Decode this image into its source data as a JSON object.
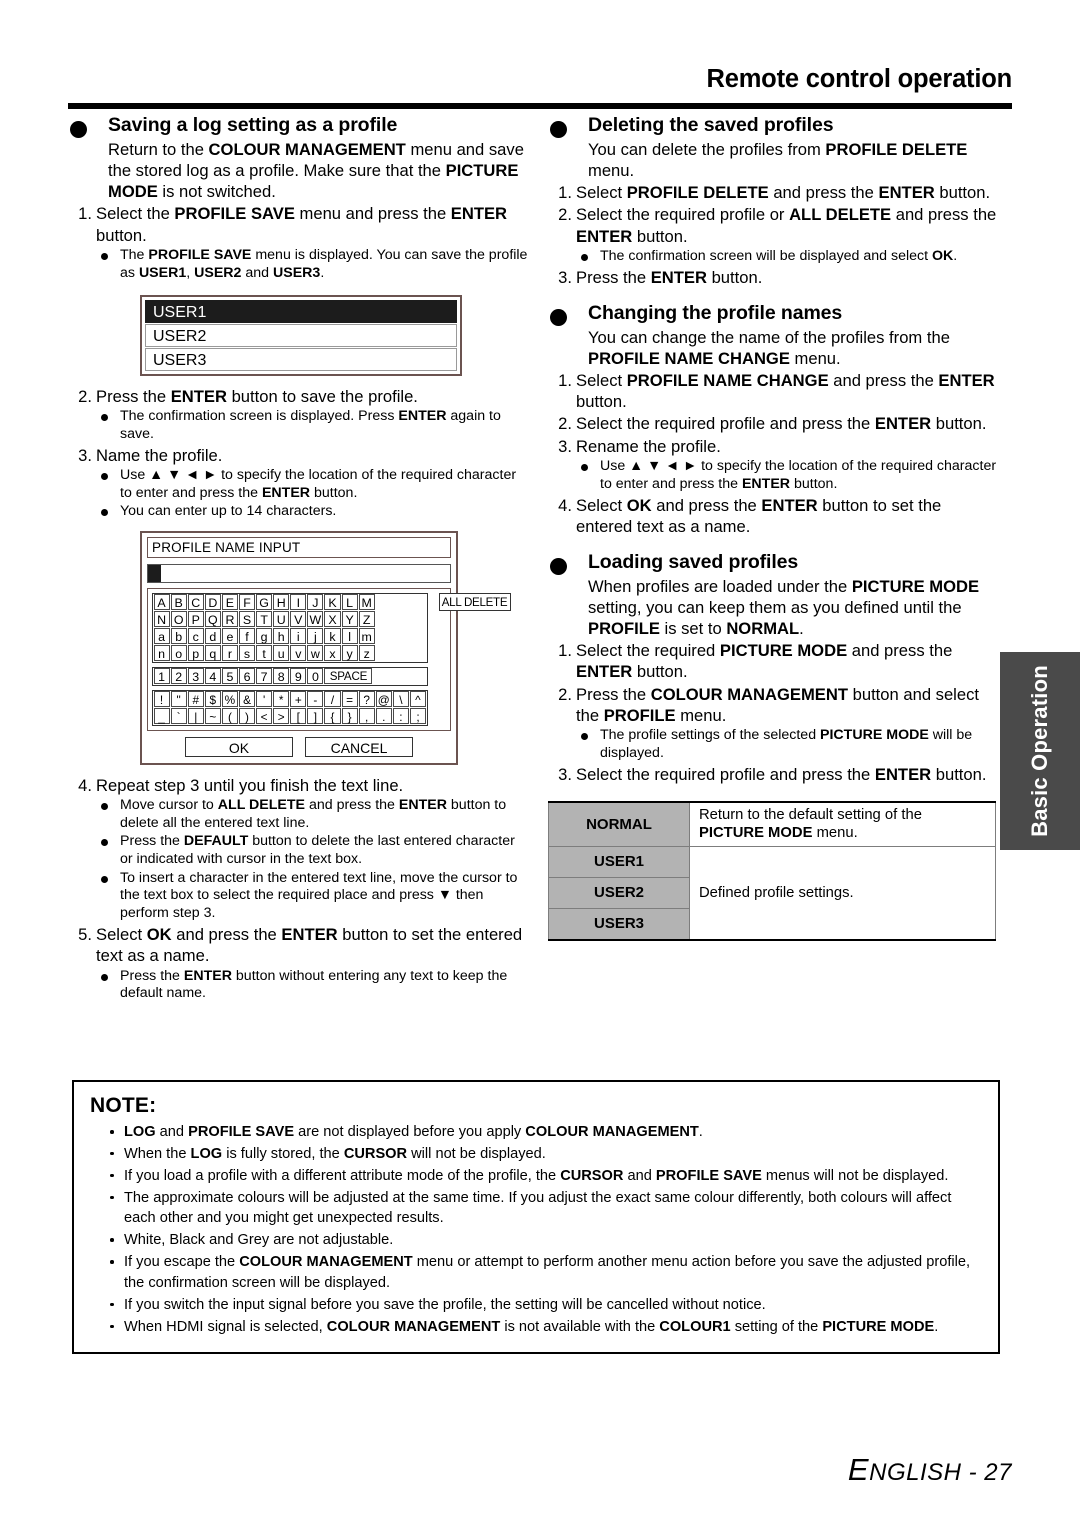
{
  "header": {
    "title": "Remote control operation"
  },
  "side_tab": {
    "label": "Basic Operation"
  },
  "footer": {
    "text_lead": "E",
    "text_caps": "NGLISH - 27"
  },
  "left_column": {
    "section1": {
      "title": "Saving a log setting as a profile",
      "intro_1": "Return to the ",
      "intro_1b": "COLOUR MANAGEMENT",
      "intro_1c": " menu",
      "intro_2": "and save the stored log as a profile. Make sure",
      "intro_3a": "that the ",
      "intro_3b": "PICTURE MODE",
      "intro_3c": " is not switched.",
      "steps": [
        {
          "num": "1.",
          "text_a": "Select the ",
          "text_b": "PROFILE SAVE",
          "text_c": " menu and press the ",
          "text_d": "ENTER",
          "text_e": " button.",
          "subs": [
            {
              "a": "The ",
              "b": "PROFILE SAVE",
              "c": " menu is displayed. You can save the profile as ",
              "d": "USER1",
              "e": ", ",
              "f": "USER2",
              "g": " and ",
              "h": "USER3",
              "i": "."
            }
          ]
        },
        {
          "num": "2.",
          "text_a": "Press the ",
          "text_b": "ENTER",
          "text_c": " button to save the profile.",
          "subs": [
            {
              "a": "The confirmation screen is displayed. Press ",
              "b": "ENTER",
              "c": " again to save."
            }
          ]
        },
        {
          "num": "3.",
          "text_a": "Name the profile.",
          "subs": [
            {
              "a": "Use ",
              "arrows": "▲ ▼ ◄ ►",
              "b": " to specify the location of the required character to enter and press the ",
              "c": "ENTER",
              "d": " button."
            },
            {
              "a": "You can enter up to 14 characters."
            }
          ]
        },
        {
          "num": "4.",
          "text_a": "Repeat step 3 until you finish the text line.",
          "subs": [
            {
              "a": "Move cursor to ",
              "b": "ALL DELETE",
              "c": " and press the ",
              "d": "ENTER",
              "e": " button to delete all the entered text line."
            },
            {
              "a": "Press the ",
              "b": "DEFAULT",
              "c": " button to delete the last entered character or indicated with cursor in the text box."
            },
            {
              "a": "To insert a character in the entered text line, move the cursor to the text box to select the required place and press ",
              "arrow": "▼",
              "b": " then perform step 3."
            }
          ]
        },
        {
          "num": "5.",
          "text_a": "Select ",
          "text_b": "OK",
          "text_c": " and press the ",
          "text_d": "ENTER",
          "text_e": " button to set the entered text as a name.",
          "subs": [
            {
              "a": "Press the ",
              "b": "ENTER",
              "c": " button without entering any text to keep the default name."
            }
          ]
        }
      ]
    },
    "user_menu": {
      "items": [
        {
          "label": "USER1",
          "selected": true
        },
        {
          "label": "USER2",
          "selected": false
        },
        {
          "label": "USER3",
          "selected": false
        }
      ]
    },
    "profile_name_input": {
      "title": "PROFILE NAME INPUT",
      "textbox_value": "",
      "all_delete_label": "ALL DELETE",
      "keyboard_rows_upper": [
        [
          "A",
          "B",
          "C",
          "D",
          "E",
          "F",
          "G",
          "H",
          "I",
          "J",
          "K",
          "L",
          "M"
        ],
        [
          "N",
          "O",
          "P",
          "Q",
          "R",
          "S",
          "T",
          "U",
          "V",
          "W",
          "X",
          "Y",
          "Z"
        ],
        [
          "a",
          "b",
          "c",
          "d",
          "e",
          "f",
          "g",
          "h",
          "i",
          "j",
          "k",
          "l",
          "m"
        ],
        [
          "n",
          "o",
          "p",
          "q",
          "r",
          "s",
          "t",
          "u",
          "v",
          "w",
          "x",
          "y",
          "z"
        ]
      ],
      "keyboard_row_numbers": [
        "1",
        "2",
        "3",
        "4",
        "5",
        "6",
        "7",
        "8",
        "9",
        "0"
      ],
      "space_label": "SPACE",
      "keyboard_rows_symbols": [
        [
          "!",
          "\"",
          "#",
          "$",
          "%",
          "&",
          "'",
          "*",
          "+",
          "-",
          "/",
          "=",
          "?",
          "@",
          "\\",
          "^"
        ],
        [
          "_",
          "`",
          "|",
          "~",
          "(",
          ")",
          "<",
          ">",
          "[",
          "]",
          "{",
          "}",
          ",",
          ".",
          ":",
          ";"
        ]
      ],
      "ok_label": "OK",
      "cancel_label": "CANCEL"
    }
  },
  "right_column": {
    "section_delete": {
      "title": "Deleting the saved profiles",
      "intro_a": "You can delete the profiles from ",
      "intro_b": "PROFILE DELETE",
      "intro_c": " menu.",
      "steps": [
        {
          "num": "1.",
          "text_a": "Select ",
          "text_b": "PROFILE DELETE",
          "text_c": " and press the ",
          "text_d": "ENTER",
          "text_e": " button."
        },
        {
          "num": "2.",
          "text_a": "Select the required profile or ",
          "text_b": "ALL DELETE",
          "text_c": " and press the ",
          "text_d": "ENTER",
          "text_e": " button.",
          "subs": [
            {
              "a": "The confirmation screen will be displayed and select ",
              "b": "OK",
              "c": "."
            }
          ]
        },
        {
          "num": "3.",
          "text_a": "Press the ",
          "text_b": "ENTER",
          "text_c": " button."
        }
      ]
    },
    "section_rename": {
      "title": "Changing the profile names",
      "intro_a": "You can change the name of the profiles from the ",
      "intro_b": "PROFILE NAME CHANGE",
      "intro_c": " menu.",
      "steps": [
        {
          "num": "1.",
          "text_a": "Select ",
          "text_b": "PROFILE NAME CHANGE",
          "text_c": " and press the ",
          "text_d": "ENTER",
          "text_e": " button."
        },
        {
          "num": "2.",
          "text_a": "Select the required profile and press the ",
          "text_b": "ENTER",
          "text_c": " button."
        },
        {
          "num": "3.",
          "text_a": "Rename the profile.",
          "subs": [
            {
              "a": "Use ",
              "arrows": "▲ ▼ ◄ ►",
              "b": " to specify the location of the required character to enter and press the ",
              "c": "ENTER",
              "d": " button."
            }
          ]
        },
        {
          "num": "4.",
          "text_a": "Select ",
          "text_b": "OK",
          "text_c": " and press the ",
          "text_d": "ENTER",
          "text_e": " button to set the entered text as a name."
        }
      ]
    },
    "section_loading": {
      "title": "Loading saved profiles",
      "intro_a": "When profiles are loaded under the ",
      "intro_b": "PICTURE MODE",
      "intro_c": " setting, you can keep them as you defined until the ",
      "intro_d": "PROFILE",
      "intro_e": " is set to ",
      "intro_f": "NORMAL",
      "intro_g": ".",
      "steps": [
        {
          "num": "1.",
          "text_a": "Select the required ",
          "text_b": "PICTURE MODE",
          "text_c": " and press the ",
          "text_d": "ENTER",
          "text_e": " button."
        },
        {
          "num": "2.",
          "text_a": "Press the ",
          "text_b": "COLOUR MANAGEMENT",
          "text_c": " button and select the ",
          "text_d": "PROFILE",
          "text_e": " menu.",
          "subs": [
            {
              "a": "The profile settings of the selected ",
              "b": "PICTURE MODE",
              "c": " will be displayed."
            }
          ]
        },
        {
          "num": "3.",
          "text_a": "Select the required profile and press the ",
          "text_b": "ENTER",
          "text_c": " button."
        }
      ]
    },
    "profile_mode_table": {
      "rows": [
        {
          "key": "NORMAL",
          "value_a": "Return to the default setting of the ",
          "value_b": "PICTURE MODE",
          "value_c": " menu."
        },
        {
          "key": "USER1",
          "value_a": ""
        },
        {
          "key": "USER2",
          "value_a": "Defined profile settings."
        },
        {
          "key": "USER3",
          "value_a": ""
        }
      ]
    }
  },
  "note": {
    "title": "NOTE:",
    "items": [
      {
        "a": "",
        "b": "LOG",
        "c": " and ",
        "d": "PROFILE SAVE",
        "e": " are not displayed before you apply ",
        "f": "COLOUR MANAGEMENT",
        "g": "."
      },
      {
        "a": "When the ",
        "b": "LOG",
        "c": " is fully stored, the ",
        "d": "CURSOR",
        "e": " will not be displayed."
      },
      {
        "a": "If you load a profile with a different attribute mode of the profile, the ",
        "b": "CURSOR",
        "c": " and ",
        "d": "PROFILE SAVE",
        "e": " menus will not be displayed."
      },
      {
        "a": "The approximate colours will be adjusted at the same time. If you adjust the exact same colour differently, both colours will affect each other and you might get unexpected results."
      },
      {
        "a": "White, Black and Grey are not adjustable."
      },
      {
        "a": "If you escape the ",
        "b": "COLOUR MANAGEMENT",
        "c": " menu or attempt to perform another menu action before you save the adjusted profile, the confirmation screen will be displayed."
      },
      {
        "a": "If you switch the input signal before you save the profile, the setting will be cancelled without notice."
      },
      {
        "a": "When HDMI signal is selected, ",
        "b": "COLOUR MANAGEMENT",
        "c": " is not available with the ",
        "d": "COLOUR1",
        "e": " setting of the ",
        "f": "PICTURE MODE",
        "g": "."
      }
    ]
  },
  "colors": {
    "sidetab_bg": "#4a4a4a",
    "table_key_bg": "#b3b3b3",
    "menu_selected_bg": "#1c1c1c",
    "screenshot_border": "#6b5350"
  }
}
